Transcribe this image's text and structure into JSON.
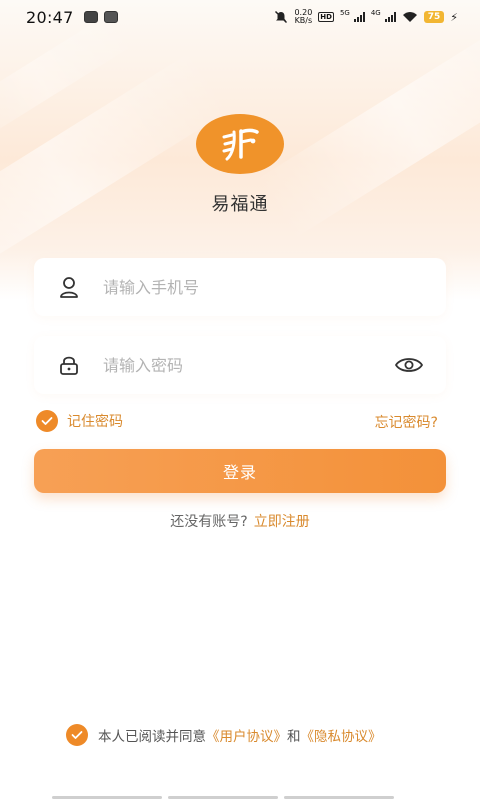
{
  "status_bar": {
    "time": "20:47",
    "net_speed_value": "0.20",
    "net_speed_unit": "KB/s",
    "network_5g": "5G",
    "network_4g": "4G",
    "battery": "75"
  },
  "app": {
    "name": "易福通"
  },
  "login_form": {
    "phone_placeholder": "请输入手机号",
    "password_placeholder": "请输入密码",
    "remember_label": "记住密码",
    "forgot_label": "忘记密码?",
    "login_button": "登录",
    "register_prompt": "还没有账号?",
    "register_link": "立即注册"
  },
  "agreement": {
    "prefix": "本人已阅读并同意",
    "user_agreement": "《用户协议》",
    "conjunction": "和",
    "privacy_agreement": "《隐私协议》",
    "checked": true
  },
  "remember_checked": true,
  "colors": {
    "accent": "#f0932a",
    "accent_text": "#d98a2e",
    "button_start": "#f7a055",
    "button_end": "#f39139"
  },
  "icons": {
    "user": "user-icon",
    "lock": "lock-icon",
    "eye": "eye-icon",
    "check": "check-icon",
    "logo": "yifutong-logo"
  }
}
